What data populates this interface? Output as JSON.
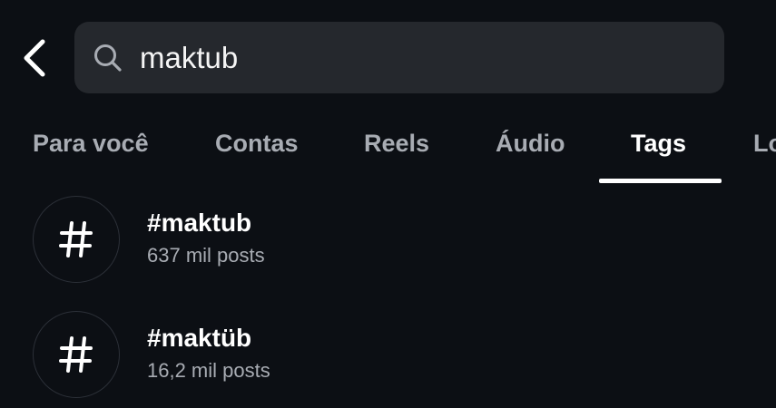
{
  "header": {
    "back_icon": "chevron-left-icon",
    "search": {
      "icon": "search-icon",
      "value": "maktub"
    }
  },
  "tabs": [
    {
      "label": "Para você",
      "active": false
    },
    {
      "label": "Contas",
      "active": false
    },
    {
      "label": "Reels",
      "active": false
    },
    {
      "label": "Áudio",
      "active": false
    },
    {
      "label": "Tags",
      "active": true
    },
    {
      "label": "Lo",
      "active": false
    }
  ],
  "results": [
    {
      "icon": "hashtag-icon",
      "name": "#maktub",
      "count": "637 mil posts"
    },
    {
      "icon": "hashtag-icon",
      "name": "#maktüb",
      "count": "16,2 mil posts"
    }
  ],
  "colors": {
    "background": "#0c0f14",
    "search_bg": "#25282d",
    "text_primary": "#ffffff",
    "text_secondary": "#a8acb3"
  }
}
